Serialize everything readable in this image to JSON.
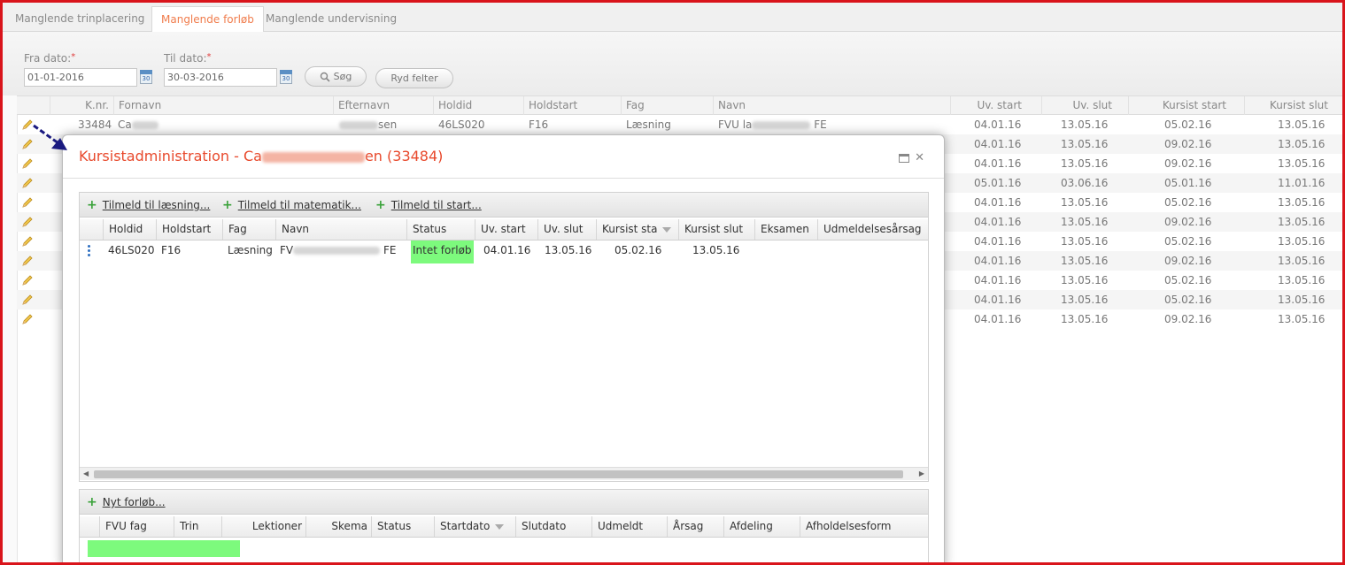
{
  "tabs": [
    {
      "label": "Manglende trinplacering",
      "active": false
    },
    {
      "label": "Manglende forløb",
      "active": true
    },
    {
      "label": "Manglende undervisning",
      "active": false
    }
  ],
  "filter": {
    "from_label": "Fra dato:",
    "from_value": "01-01-2016",
    "to_label": "Til dato:",
    "to_value": "30-03-2016",
    "required_mark": "*",
    "cal_text": "30",
    "search_label": "Søg",
    "clear_label": "Ryd felter"
  },
  "grid": {
    "columns": [
      "K.nr.",
      "Fornavn",
      "Efternavn",
      "Holdid",
      "Holdstart",
      "Fag",
      "Navn",
      "Uv. start",
      "Uv. slut",
      "Kursist start",
      "Kursist slut"
    ],
    "first_row": {
      "knr": "33484",
      "fornavn": "Ca",
      "efternavn": "sen",
      "holdid": "46LS020",
      "holdstart": "F16",
      "fag": "Læsning",
      "navn_prefix": "FVU la",
      "navn_suffix": "FE"
    },
    "rows": [
      [
        "04.01.16",
        "13.05.16",
        "05.02.16",
        "13.05.16"
      ],
      [
        "04.01.16",
        "13.05.16",
        "09.02.16",
        "13.05.16"
      ],
      [
        "04.01.16",
        "13.05.16",
        "09.02.16",
        "13.05.16"
      ],
      [
        "05.01.16",
        "03.06.16",
        "05.01.16",
        "11.01.16"
      ],
      [
        "04.01.16",
        "13.05.16",
        "05.02.16",
        "13.05.16"
      ],
      [
        "04.01.16",
        "13.05.16",
        "09.02.16",
        "13.05.16"
      ],
      [
        "04.01.16",
        "13.05.16",
        "05.02.16",
        "13.05.16"
      ],
      [
        "04.01.16",
        "13.05.16",
        "09.02.16",
        "13.05.16"
      ],
      [
        "04.01.16",
        "13.05.16",
        "05.02.16",
        "13.05.16"
      ],
      [
        "04.01.16",
        "13.05.16",
        "05.02.16",
        "13.05.16"
      ],
      [
        "04.01.16",
        "13.05.16",
        "09.02.16",
        "13.05.16"
      ]
    ]
  },
  "dialog": {
    "title_prefix": "Kursistadministration - Ca",
    "title_suffix": "en (33484)",
    "top_panel": {
      "links": [
        "Tilmeld til læsning...",
        "Tilmeld til matematik...",
        "Tilmeld til start..."
      ],
      "columns": [
        "Holdid",
        "Holdstart",
        "Fag",
        "Navn",
        "Status",
        "Uv. start",
        "Uv. slut",
        "Kursist sta",
        "Kursist slut",
        "Eksamen",
        "Udmeldelsesårsag"
      ],
      "row": {
        "holdid": "46LS020",
        "holdstart": "F16",
        "fag": "Læsning",
        "navn_prefix": "FV",
        "navn_suffix": "FE",
        "status": "Intet forløb",
        "uv_start": "04.01.16",
        "uv_slut": "13.05.16",
        "kursist_start": "05.02.16",
        "kursist_slut": "13.05.16"
      }
    },
    "bottom_panel": {
      "link": "Nyt forløb...",
      "columns": [
        "FVU fag",
        "Trin",
        "Lektioner",
        "Skema",
        "Status",
        "Startdato",
        "Slutdato",
        "Udmeldt",
        "Årsag",
        "Afdeling",
        "Afholdelsesform"
      ]
    }
  },
  "colors": {
    "accent": "#f07c4c",
    "title": "#e8492c",
    "status_green": "#7dfa7d",
    "frame": "#d9141b"
  }
}
